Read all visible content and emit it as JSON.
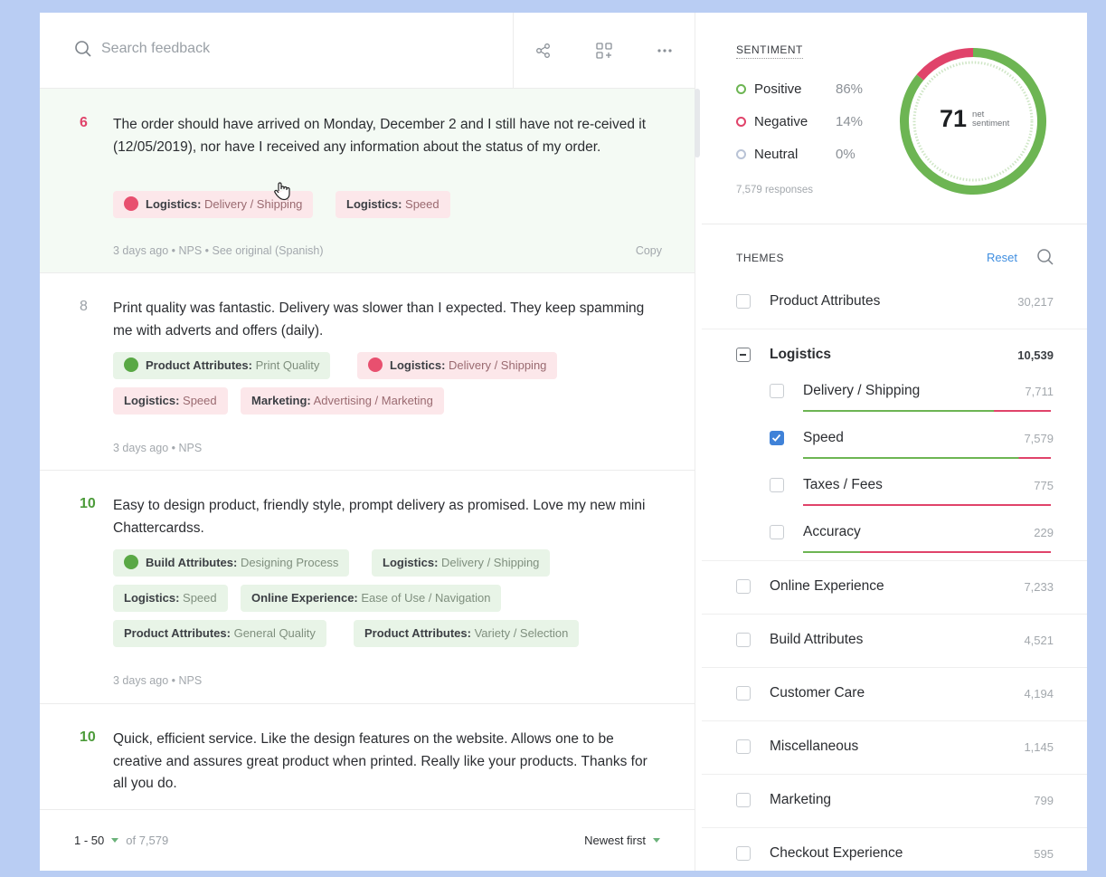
{
  "search": {
    "placeholder": "Search feedback"
  },
  "toolbar": {
    "icons": [
      "share-icon",
      "grid-add-icon",
      "more-icon"
    ]
  },
  "feedback": [
    {
      "score": "6",
      "text": "The order should have arrived on Monday, December 2 and I still have not re-ceived it (12/05/2019), nor have I received any information about the status of my order.",
      "tags": [
        {
          "cat": "Logistics:",
          "sub": " Delivery / Shipping",
          "sentiment": "negative"
        },
        {
          "cat": "Logistics:",
          "sub": " Speed",
          "sentiment": "negative"
        }
      ],
      "meta": "3 days ago  •  NPS  •  See original (Spanish)",
      "copy": "Copy"
    },
    {
      "score": "8",
      "text": "Print quality was fantastic. Delivery was slower than I expected. They keep spamming me with adverts and offers (daily).",
      "tags": [
        {
          "cat": "Product Attributes:",
          "sub": " Print Quality",
          "sentiment": "positive"
        },
        {
          "cat": "Logistics:",
          "sub": " Delivery / Shipping",
          "sentiment": "negative"
        },
        {
          "cat": "Logistics:",
          "sub": " Speed",
          "sentiment": "negative"
        },
        {
          "cat": "Marketing:",
          "sub": " Advertising / Marketing",
          "sentiment": "negative"
        }
      ],
      "meta": "3 days ago  •  NPS"
    },
    {
      "score": "10",
      "text": "Easy to design product, friendly style, prompt delivery as promised. Love my new mini Chattercardss.",
      "tags": [
        {
          "cat": "Build Attributes:",
          "sub": " Designing Process",
          "sentiment": "positive"
        },
        {
          "cat": "Logistics:",
          "sub": " Delivery / Shipping",
          "sentiment": "positive"
        },
        {
          "cat": "Logistics:",
          "sub": " Speed",
          "sentiment": "positive"
        },
        {
          "cat": "Online Experience:",
          "sub": " Ease of Use / Navigation",
          "sentiment": "positive"
        },
        {
          "cat": "Product Attributes:",
          "sub": " General Quality",
          "sentiment": "positive"
        },
        {
          "cat": "Product Attributes:",
          "sub": " Variety / Selection",
          "sentiment": "positive"
        }
      ],
      "meta": "3 days ago  •  NPS"
    },
    {
      "score": "10",
      "text": "Quick, efficient service. Like the design features on the website. Allows one to be creative and assures great product when printed. Really like your products. Thanks for all you do."
    }
  ],
  "pagination": {
    "range": "1 - 50",
    "of": "of 7,579",
    "sort": "Newest first"
  },
  "sentiment": {
    "title": "SENTIMENT",
    "positive": {
      "label": "Positive",
      "pct": "86%",
      "value": 86
    },
    "negative": {
      "label": "Negative",
      "pct": "14%",
      "value": 14
    },
    "neutral": {
      "label": "Neutral",
      "pct": "0%",
      "value": 0
    },
    "responses": "7,579 responses",
    "net": "71",
    "net_label_1": "net",
    "net_label_2": "sentiment",
    "colors": {
      "positive": "#6db553",
      "negative": "#e0436a",
      "neutral": "#b9c3d6"
    }
  },
  "themes": {
    "title": "THEMES",
    "reset": "Reset",
    "items": [
      {
        "label": "Product Attributes",
        "count": "30,217"
      },
      {
        "label": "Logistics",
        "count": "10,539",
        "expanded": true
      },
      {
        "label": "Delivery / Shipping",
        "count": "7,711",
        "child": true,
        "pos": 0.77
      },
      {
        "label": "Speed",
        "count": "7,579",
        "child": true,
        "checked": true,
        "pos": 0.87
      },
      {
        "label": "Taxes / Fees",
        "count": "775",
        "child": true,
        "pos": 0.0
      },
      {
        "label": "Accuracy",
        "count": "229",
        "child": true,
        "pos": 0.23
      },
      {
        "label": "Online Experience",
        "count": "7,233"
      },
      {
        "label": "Build Attributes",
        "count": "4,521"
      },
      {
        "label": "Customer Care",
        "count": "4,194"
      },
      {
        "label": "Miscellaneous",
        "count": "1,145"
      },
      {
        "label": "Marketing",
        "count": "799"
      },
      {
        "label": "Checkout Experience",
        "count": "595"
      }
    ]
  }
}
